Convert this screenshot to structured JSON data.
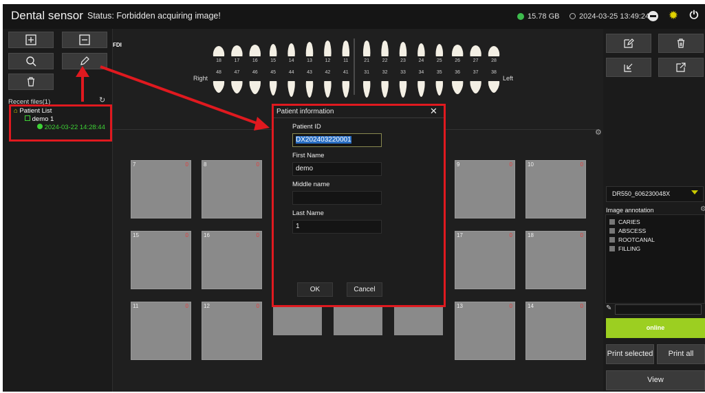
{
  "titlebar": {
    "app_title": "Dental sensor",
    "status": "Status: Forbidden acquiring image!",
    "disk_free": "15.78 GB",
    "datetime": "2024-03-25 13:49:24"
  },
  "toolbar": {
    "add_icon": "plus-square-icon",
    "remove_icon": "minus-square-icon",
    "search_icon": "search-icon",
    "edit_icon": "pencil-icon",
    "delete_icon": "trash-icon"
  },
  "recent": {
    "label": "Recent files(1)",
    "tree": {
      "root": "Patient List",
      "patient": "demo 1",
      "session": "2024-03-22 14:28:44"
    }
  },
  "chart": {
    "fdi_label": "FDI",
    "right_label": "Right",
    "left_label": "Left",
    "upper_numbers": [
      "18",
      "17",
      "16",
      "15",
      "14",
      "13",
      "12",
      "11",
      "21",
      "22",
      "23",
      "24",
      "25",
      "26",
      "27",
      "28"
    ],
    "lower_numbers": [
      "48",
      "47",
      "46",
      "45",
      "44",
      "43",
      "42",
      "41",
      "31",
      "32",
      "33",
      "34",
      "35",
      "36",
      "37",
      "38"
    ]
  },
  "slots": {
    "row1": [
      {
        "label": "7",
        "mark": "0"
      },
      {
        "label": "8",
        "mark": "0"
      },
      {
        "label": "9",
        "mark": "0"
      },
      {
        "label": "10",
        "mark": "0"
      }
    ],
    "row2": [
      {
        "label": "15",
        "mark": "0"
      },
      {
        "label": "16",
        "mark": "0"
      },
      {
        "label": "17",
        "mark": "0"
      },
      {
        "label": "18",
        "mark": "0"
      }
    ],
    "row3": [
      {
        "label": "11",
        "mark": "0"
      },
      {
        "label": "12",
        "mark": "0"
      },
      {
        "label": "13",
        "mark": "0"
      },
      {
        "label": "14",
        "mark": "0"
      }
    ]
  },
  "dialog": {
    "title": "Patient information",
    "close": "✕",
    "patient_id_label": "Patient ID",
    "patient_id": "DX202403220001",
    "first_name_label": "First Name",
    "first_name": "demo",
    "middle_name_label": "Middle name",
    "middle_name": "",
    "last_name_label": "Last Name",
    "last_name": "1",
    "ok": "OK",
    "cancel": "Cancel"
  },
  "right": {
    "device": "DR550_606230048X",
    "annotation_title": "Image annotation",
    "annotations": [
      "CARIES",
      "ABSCESS",
      "ROOTCANAL",
      "FILLING"
    ],
    "online": "online",
    "print_selected": "Print selected",
    "print_all": "Print all",
    "view": "View"
  },
  "colors": {
    "highlight_red": "#e0191f",
    "online_green": "#9ccf21",
    "tree_green": "#3ed236",
    "selection_blue": "#2a6fc4"
  }
}
